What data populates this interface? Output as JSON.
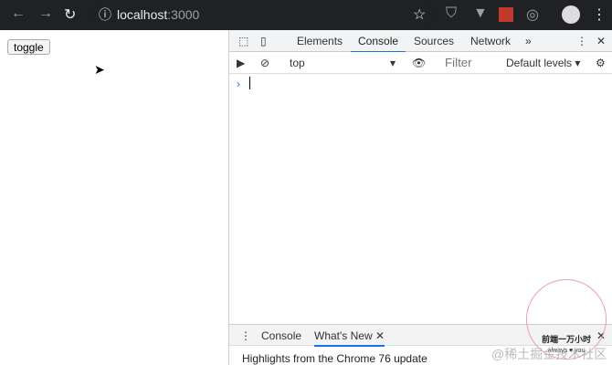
{
  "browser": {
    "url_host": "localhost",
    "url_port": ":3000"
  },
  "page": {
    "toggle_label": "toggle"
  },
  "devtools": {
    "tabs": [
      "Elements",
      "Console",
      "Sources",
      "Network"
    ],
    "more": "»",
    "context": "top",
    "filter_placeholder": "Filter",
    "levels": "Default levels ▾",
    "prompt": "›",
    "drawer_tabs": [
      "Console",
      "What's New"
    ],
    "highlights": "Highlights from the Chrome 76 update"
  },
  "watermark": {
    "title": "前端一万小时",
    "sub": "always ♥ you",
    "site": "@稀土掘金技术社区"
  }
}
